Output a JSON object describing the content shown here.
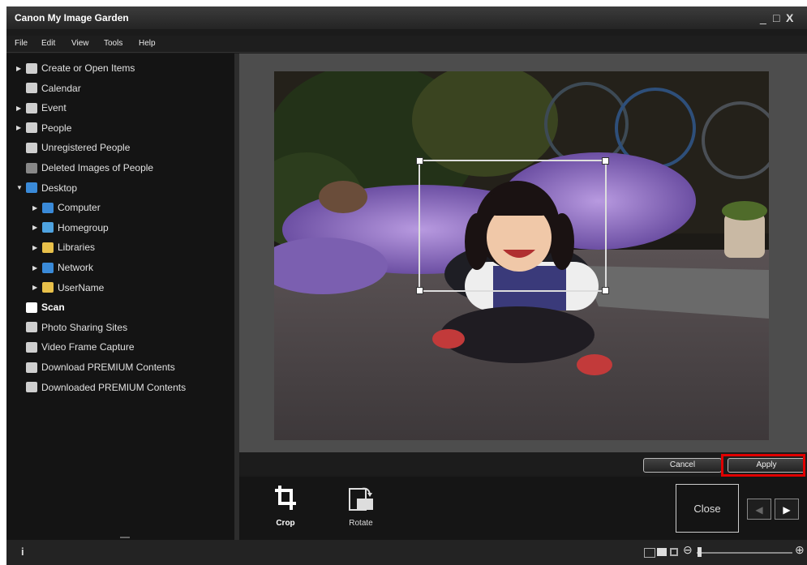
{
  "window": {
    "title": "Canon My Image Garden",
    "controls": [
      "_",
      "□",
      "X"
    ]
  },
  "menubar": {
    "items": [
      "File",
      "Edit",
      "View",
      "Tools",
      "Help"
    ]
  },
  "sidebar": {
    "items": [
      {
        "label": "Create or Open Items",
        "icon": "create-items-icon",
        "expand": "▶",
        "level": 0
      },
      {
        "label": "Calendar",
        "icon": "calendar-icon",
        "expand": "",
        "level": 0
      },
      {
        "label": "Event",
        "icon": "event-icon",
        "expand": "▶",
        "level": 0
      },
      {
        "label": "People",
        "icon": "people-icon",
        "expand": "▶",
        "level": 0
      },
      {
        "label": "Unregistered People",
        "icon": "unregistered-people-icon",
        "expand": "",
        "level": 0
      },
      {
        "label": "Deleted Images of People",
        "icon": "deleted-people-icon",
        "expand": "",
        "level": 0
      },
      {
        "label": "Desktop",
        "icon": "desktop-icon",
        "expand": "▼",
        "level": 0
      },
      {
        "label": "Computer",
        "icon": "computer-icon",
        "expand": "▶",
        "level": 1
      },
      {
        "label": "Homegroup",
        "icon": "homegroup-icon",
        "expand": "▶",
        "level": 1
      },
      {
        "label": "Libraries",
        "icon": "libraries-icon",
        "expand": "▶",
        "level": 1
      },
      {
        "label": "Network",
        "icon": "network-icon",
        "expand": "▶",
        "level": 1
      },
      {
        "label": "UserName",
        "icon": "user-folder-icon",
        "expand": "▶",
        "level": 1
      },
      {
        "label": "Scan",
        "icon": "scan-icon",
        "expand": "",
        "level": 0
      },
      {
        "label": "Photo Sharing Sites",
        "icon": "photo-sharing-icon",
        "expand": "",
        "level": 0
      },
      {
        "label": "Video Frame Capture",
        "icon": "video-frame-icon",
        "expand": "",
        "level": 0
      },
      {
        "label": "Download PREMIUM Contents",
        "icon": "download-premium-icon",
        "expand": "",
        "level": 0
      },
      {
        "label": "Downloaded PREMIUM Contents",
        "icon": "downloaded-premium-icon",
        "expand": "",
        "level": 0
      }
    ]
  },
  "buttons": {
    "cancel": "Cancel",
    "apply": "Apply",
    "close": "Close",
    "prev": "◀",
    "next": "▶"
  },
  "tools": {
    "crop": "Crop",
    "rotate": "Rotate"
  },
  "statusbar": {
    "info": "i",
    "zoom_out": "⊖",
    "zoom_in": "⊕"
  },
  "colors": {
    "highlight": "#e00000",
    "tree_icon_blue": "#3a8ad8"
  }
}
